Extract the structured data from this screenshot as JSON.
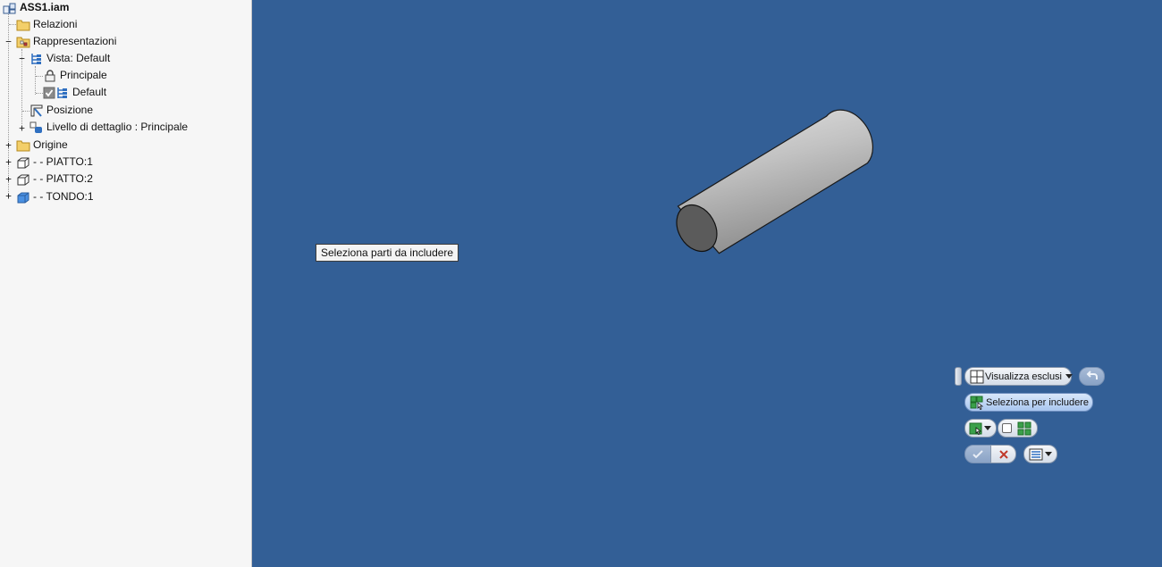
{
  "browser": {
    "root": {
      "label": "ASS1.iam",
      "icon": "assembly-icon"
    },
    "items": [
      {
        "label": "Relazioni",
        "icon": "folder-icon"
      },
      {
        "label": "Rappresentazioni",
        "icon": "representations-icon"
      },
      {
        "label": "Vista: Default",
        "icon": "view-representation-icon"
      },
      {
        "label": "Principale",
        "icon": "lock-icon"
      },
      {
        "label": "Default",
        "icon": "view-representation-icon"
      },
      {
        "label": "Posizione",
        "icon": "position-icon"
      },
      {
        "label": "Livello di dettaglio : Principale",
        "icon": "level-of-detail-icon"
      },
      {
        "label": "Origine",
        "icon": "folder-icon"
      },
      {
        "label": "- - PIATTO:1",
        "icon": "part-icon"
      },
      {
        "label": "- - PIATTO:2",
        "icon": "part-icon"
      },
      {
        "label": "- - TONDO:1",
        "icon": "solid-part-icon"
      }
    ]
  },
  "viewport": {
    "background_color": "#335f96",
    "tooltip": "Seleziona parti da includere"
  },
  "minitoolbar": {
    "show_excluded_label": "Visualizza esclusi",
    "select_to_include_label": "Seleziona per includere",
    "icons": {
      "grip": "grip-icon",
      "show_excluded": "window-grid-icon",
      "undo": "undo-icon",
      "select_include": "select-include-icon",
      "selection_mode": "selection-mode-icon",
      "checkbox": "checkbox-icon",
      "select_all": "grid-select-icon",
      "ok": "checkmark-icon",
      "cancel": "close-icon",
      "options": "options-menu-icon"
    }
  }
}
